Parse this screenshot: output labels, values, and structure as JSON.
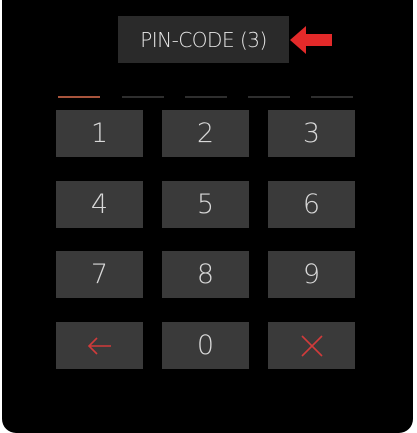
{
  "header": {
    "title": "PIN-CODE (3)",
    "pointer_icon": "arrow-left-icon",
    "pointer_color": "#e32a2a"
  },
  "pin": {
    "length": 5,
    "entered": 1,
    "active_color": "#a8543c",
    "inactive_color": "#2e2e2e"
  },
  "keypad": {
    "keys": [
      "1",
      "2",
      "3",
      "4",
      "5",
      "6",
      "7",
      "8",
      "9"
    ],
    "zero": "0",
    "backspace_icon": "arrow-left-icon",
    "clear_icon": "close-icon",
    "icon_color": "#d13b3b"
  }
}
